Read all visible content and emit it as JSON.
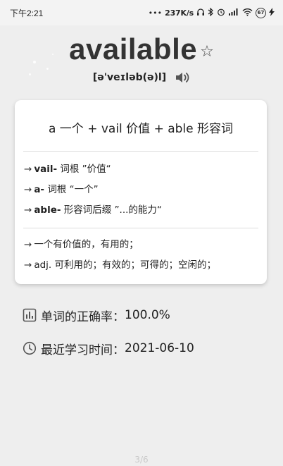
{
  "status_bar": {
    "time": "下午2:21",
    "network_speed": "237K/s",
    "battery": "67"
  },
  "word": {
    "text": "available",
    "phonetic": "[ə'veɪləb(ə)l]"
  },
  "card": {
    "etymology": "a 一个 + vail 价值 + able 形容词",
    "roots": [
      {
        "term": "vail-",
        "desc": " 词根 ”价值“"
      },
      {
        "term": "a-",
        "desc": " 词根 “一个”"
      },
      {
        "term": "able-",
        "desc": " 形容词后缀 ”...的能力“"
      }
    ],
    "meanings": [
      "一个有价值的，有用的；",
      "adj. 可利用的；有效的；可得的；空闲的；"
    ],
    "arrow": "→"
  },
  "stats": {
    "accuracy_label": "单词的正确率：",
    "accuracy_value": "100.0%",
    "recent_label": "最近学习时间：",
    "recent_value": "2021-06-10"
  },
  "page_indicator": "3/6",
  "icons": {
    "favorite": "star-outline-icon",
    "pronounce": "speaker-icon",
    "accuracy": "bar-chart-icon",
    "recent": "clock-icon"
  }
}
